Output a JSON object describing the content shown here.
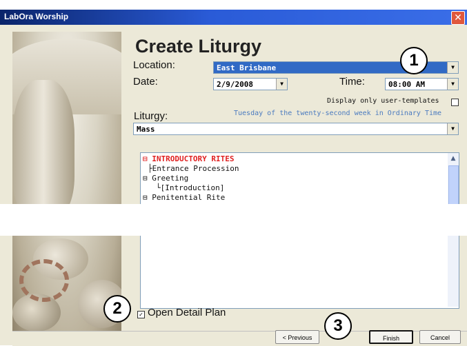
{
  "window": {
    "title": "LabOra Worship",
    "close_glyph": "✕"
  },
  "heading": "Create Liturgy",
  "form": {
    "location_label": "Location:",
    "location_value": "East Brisbane",
    "date_label": "Date:",
    "date_value": "2/9/2008",
    "time_label": "Time:",
    "time_value": "08:00 AM",
    "user_templates_label": "Display only user-templates",
    "liturgy_label": "Liturgy:",
    "liturgy_day": "Tuesday of the twenty-second week in Ordinary Time",
    "liturgy_value": "Mass"
  },
  "tree": {
    "items": [
      {
        "prefix": "⊟",
        "label": "INTRODUCTORY RITES"
      },
      {
        "prefix": "├",
        "label": "Entrance Procession"
      },
      {
        "prefix": "⊟",
        "label": "Greeting"
      },
      {
        "prefix": "└",
        "label": "[Introduction]"
      },
      {
        "prefix": "⊟",
        "label": "Penitential Rite"
      }
    ]
  },
  "options": {
    "open_detail_label": "Open Detail Plan",
    "open_detail_checked": true
  },
  "buttons": {
    "previous": "< Previous",
    "finish": "Finish",
    "cancel": "Cancel"
  },
  "callouts": [
    "1",
    "2",
    "3"
  ],
  "colors": {
    "titlebar": "#0a246a",
    "selection": "#316ac5",
    "tree_red": "#e02020",
    "day_text": "#4a7abf"
  }
}
